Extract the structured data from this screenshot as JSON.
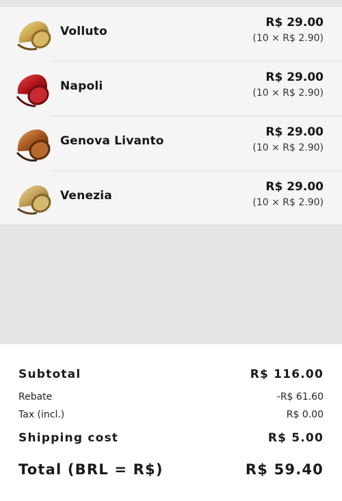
{
  "cart": {
    "items": [
      {
        "name": "Volluto",
        "price": "R$ 29.00",
        "unit_breakdown": "(10 × R$ 2.90)"
      },
      {
        "name": "Napoli",
        "price": "R$ 29.00",
        "unit_breakdown": "(10 × R$ 2.90)"
      },
      {
        "name": "Genova Livanto",
        "price": "R$ 29.00",
        "unit_breakdown": "(10 × R$ 2.90)"
      },
      {
        "name": "Venezia",
        "price": "R$ 29.00",
        "unit_breakdown": "(10 × R$ 2.90)"
      }
    ]
  },
  "summary": {
    "subtotal_label": "Subtotal",
    "subtotal_value": "R$ 116.00",
    "rebate_label": "Rebate",
    "rebate_value": "-R$ 61.60",
    "tax_label": "Tax (incl.)",
    "tax_value": "R$ 0.00",
    "shipping_label": "Shipping cost",
    "shipping_value": "R$ 5.00",
    "total_label": "Total (BRL = R$)",
    "total_value": "R$ 59.40"
  },
  "colors": {
    "capsule_volluto": "#c9a44a",
    "capsule_napoli": "#b3141c",
    "capsule_genova": "#a8581f",
    "capsule_venezia": "#c3a058"
  }
}
